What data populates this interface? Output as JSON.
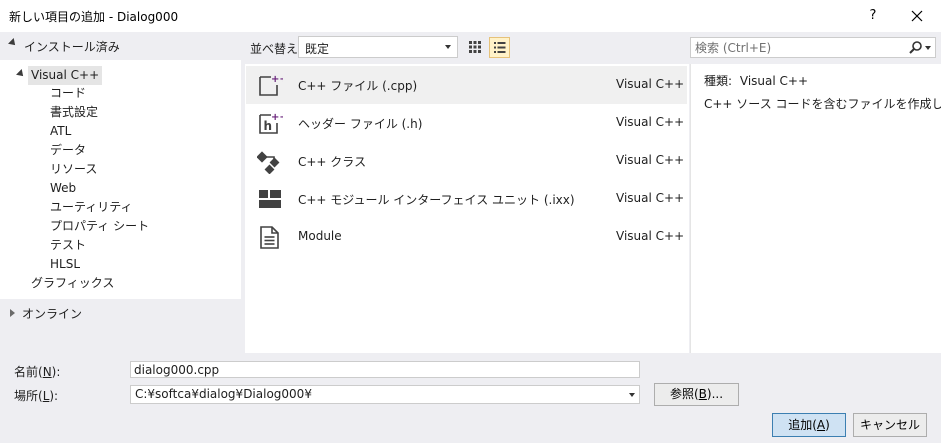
{
  "window": {
    "title": "新しい項目の追加 - Dialog000",
    "help_label": "?"
  },
  "left": {
    "installed_label": "インストール済み",
    "tree_root": "Visual C++",
    "tree_children": [
      "コード",
      "書式設定",
      "ATL",
      "データ",
      "リソース",
      "Web",
      "ユーティリティ",
      "プロパティ シート",
      "テスト",
      "HLSL"
    ],
    "graphics_label": "グラフィックス",
    "online_label": "オンライン"
  },
  "toolbar": {
    "sort_label": "並べ替え:",
    "sort_value": "既定"
  },
  "search": {
    "placeholder": "検索 (Ctrl+E)"
  },
  "templates": [
    {
      "name": "C++ ファイル (.cpp)",
      "lang": "Visual C++",
      "icon": "cpp-file-icon"
    },
    {
      "name": "ヘッダー ファイル (.h)",
      "lang": "Visual C++",
      "icon": "header-file-icon"
    },
    {
      "name": "C++ クラス",
      "lang": "Visual C++",
      "icon": "class-icon"
    },
    {
      "name": "C++ モジュール インターフェイス ユニット (.ixx)",
      "lang": "Visual C++",
      "icon": "module-interface-icon"
    },
    {
      "name": "Module",
      "lang": "Visual C++",
      "icon": "module-file-icon"
    }
  ],
  "details": {
    "type_label": "種類:",
    "type_value": "Visual C++",
    "description": "C++ ソース コードを含むファイルを作成します"
  },
  "form": {
    "name_label": "名前(",
    "name_key": "N",
    "name_suffix": "):",
    "name_value": "dialog000.cpp",
    "location_label": "場所(",
    "location_key": "L",
    "location_suffix": "):",
    "location_value": "C:¥softca¥dialog¥Dialog000¥",
    "browse_label": "参照(",
    "browse_key": "B",
    "browse_suffix": ")...",
    "add_label": "追加(",
    "add_key": "A",
    "add_suffix": ")",
    "cancel_label": "キャンセル"
  },
  "colors": {
    "accent": "#68217a",
    "selection": "#f0f0f0",
    "primary_button": "#cfe2f3"
  }
}
